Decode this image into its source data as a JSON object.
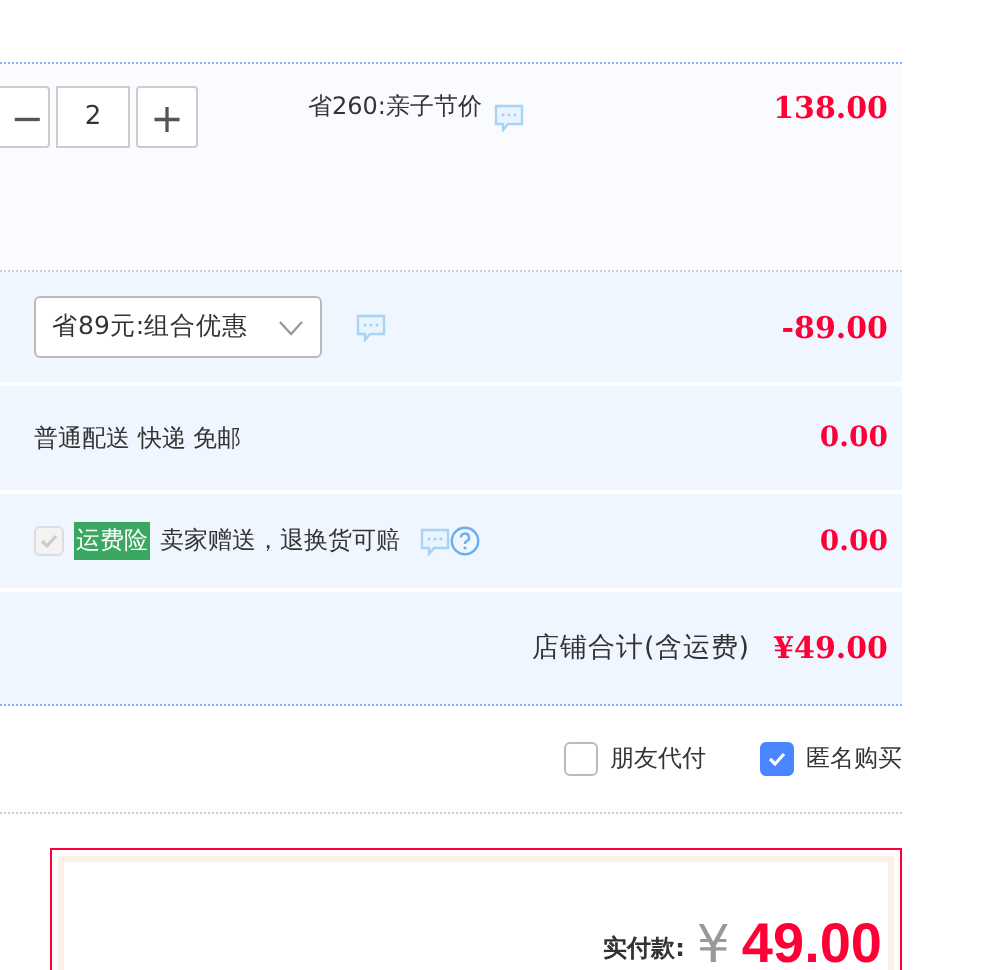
{
  "item": {
    "quantity": {
      "minus": "−",
      "value": "2",
      "plus": "+"
    },
    "promo": "省260:亲子节价",
    "price": "138.00"
  },
  "discount": {
    "select": "省89元:组合优惠",
    "amount": "-89.00"
  },
  "shipping": {
    "text": "普通配送 快递 免邮",
    "amount": "0.00"
  },
  "insurance": {
    "checked": true,
    "disabled": true,
    "tag": "运费险",
    "text": "卖家赠送，退换货可赔",
    "amount": "0.00"
  },
  "shop_total": {
    "label": "店铺合计(含运费)",
    "amount": "¥49.00"
  },
  "options": [
    {
      "label": "朋友代付",
      "checked": false
    },
    {
      "label": "匿名购买",
      "checked": true
    }
  ],
  "payment": {
    "label": "实付款:",
    "currency": "¥",
    "amount": "49.00"
  }
}
